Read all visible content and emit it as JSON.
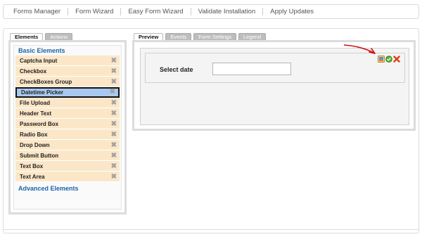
{
  "top_menu": [
    "Forms Manager",
    "Form Wizard",
    "Easy Form Wizard",
    "Validate Installation",
    "Apply Updates"
  ],
  "left_tabs": [
    "Elements",
    "Actions"
  ],
  "right_tabs": [
    "Preview",
    "Events",
    "Form Settings",
    "Legend"
  ],
  "sections": {
    "basic": "Basic Elements",
    "advanced": "Advanced Elements"
  },
  "elements": [
    "Captcha Input",
    "Checkbox",
    "CheckBoxes Group",
    "Datetime Picker",
    "File Upload",
    "Header Text",
    "Password Box",
    "Radio Box",
    "Drop Down",
    "Submit Button",
    "Text Box",
    "Text Area"
  ],
  "selected_element": "Datetime Picker",
  "preview": {
    "field_label": "Select date",
    "field_value": ""
  },
  "colors": {
    "element_bg": "#fbe7c8",
    "selected_bg": "#a8c8f0",
    "section_title": "#1d63a8",
    "arrow": "#cc1111"
  },
  "icons": [
    "edit-icon",
    "settings-icon",
    "delete-icon",
    "remove-icon"
  ]
}
